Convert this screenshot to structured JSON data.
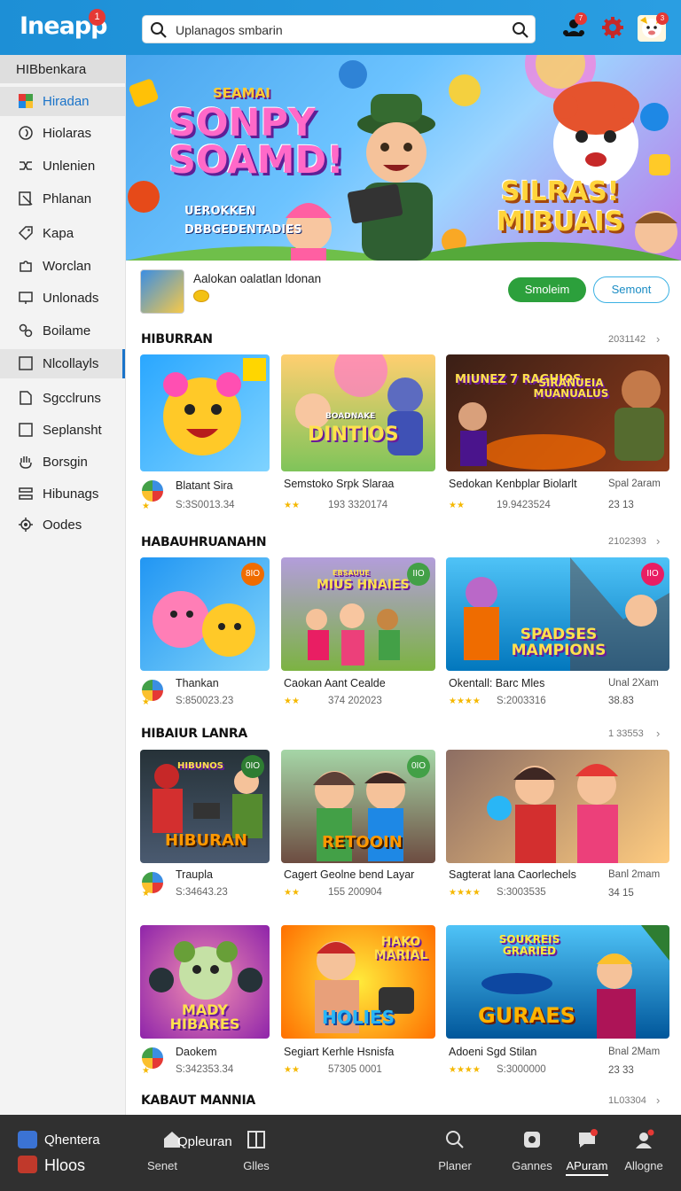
{
  "app": {
    "logo_text": "Ineapp",
    "logo_badge": "1"
  },
  "search": {
    "value": "Uplanagos smbarin"
  },
  "top_icons": [
    {
      "name": "people-icon",
      "badge": "7"
    },
    {
      "name": "gear-icon"
    },
    {
      "name": "avatar",
      "badge": "3"
    }
  ],
  "sidebar": {
    "header": "HIBbenkara",
    "items": [
      {
        "label": "Hiradan",
        "icon": "game-colorful-icon",
        "state": "active"
      },
      {
        "label": "Hiolaras",
        "icon": "swirl-icon"
      },
      {
        "label": "Unlenien",
        "icon": "shuffle-icon"
      },
      {
        "label": "Phlanan",
        "icon": "document-edit-icon"
      },
      {
        "label": "Kapa",
        "icon": "tag-icon"
      },
      {
        "label": "Worclan",
        "icon": "puzzle-icon"
      },
      {
        "label": "Unlonads",
        "icon": "monitor-icon"
      },
      {
        "label": "Boilame",
        "icon": "cluster-icon"
      },
      {
        "label": "Nlcollayls",
        "icon": "checkbox-icon",
        "state": "boxed"
      },
      {
        "label": "Sgcclruns",
        "icon": "page-icon"
      },
      {
        "label": "Seplansht",
        "icon": "square-icon"
      },
      {
        "label": "Borsgin",
        "icon": "hand-icon"
      },
      {
        "label": "Hibunags",
        "icon": "stack-icon"
      },
      {
        "label": "Oodes",
        "icon": "gear-icon"
      }
    ]
  },
  "hero": {
    "small_title": "SEAMAI",
    "main_title_1": "SONPY",
    "main_title_2": "SOAMD!",
    "subtitle_1": "UEROKKEN",
    "subtitle_2": "DBBGEDENTADIES",
    "right_title_1": "SILRAS!",
    "right_title_2": "MIBUAIS"
  },
  "featured": {
    "title": "Aalokan oalatlan ldonan",
    "primary_button": "Smoleim",
    "secondary_button": "Semont"
  },
  "sections": [
    {
      "title": "HIBURRAN",
      "meta": "2031142",
      "cards": [
        {
          "name": "Blatant Sira",
          "sub": "S:3S0013.34",
          "art": "",
          "badge": "",
          "rating": "★"
        },
        {
          "name": "Semstoko Srpk Slaraa",
          "sub": "193 3320174",
          "art": "DINTIOS",
          "art_top": "BOADNAKE",
          "badge": "",
          "rating": "★★"
        },
        {
          "name": "Sedokan Kenbplar Biolarlt",
          "sub": "19.9423524",
          "art": "SIRANUEIA MUANUALUS",
          "art_top": "MIUNEZ 7 RAGHIOS",
          "badge": "",
          "rating": "★★",
          "right_top": "Spal 2aram",
          "right_bottom": "23 13"
        }
      ]
    },
    {
      "title": "HABAUHRUANAHN",
      "meta": "2102393",
      "cards": [
        {
          "name": "Thankan",
          "sub": "S:850023.23",
          "art": "",
          "badge": "8IO",
          "rating": "★"
        },
        {
          "name": "Caokan Aant Cealde",
          "sub": "374 202023",
          "art": "MIUS HNAIES",
          "art_top": "EBSAUUE",
          "badge": "IIO",
          "rating": "★★"
        },
        {
          "name": "Okentall: Barc Mles",
          "sub": "S:2003316",
          "art": "SPADSES MAMPIONS",
          "badge": "IIO",
          "rating": "★★★★",
          "right_top": "Unal 2Xam",
          "right_bottom": "38.83"
        }
      ]
    },
    {
      "title": "HIBAIUR LANRA",
      "meta": "1 33553",
      "cards": [
        {
          "name": "Traupla",
          "sub": "S:34643.23",
          "art": "HIBURAN",
          "art_top": "HIBUNOS",
          "badge": "0IO",
          "rating": "★"
        },
        {
          "name": "Cagert Geolne bend Layar",
          "sub": "155 200904",
          "art": "RETOOIN",
          "badge": "0IO",
          "rating": "★★"
        },
        {
          "name": "Sagterat lana Caorlechels",
          "sub": "S:3003535",
          "art": "",
          "badge": "",
          "rating": "★★★★",
          "right_top": "Banl 2mam",
          "right_bottom": "34 15"
        }
      ]
    },
    {
      "title": "",
      "meta": "",
      "cards": [
        {
          "name": "Daokem",
          "sub": "S:342353.34",
          "art": "MADY HIBARES",
          "badge": "",
          "rating": "★"
        },
        {
          "name": "Segiart Kerhle Hsnisfa",
          "sub": "57305 0001",
          "art": "HOLIES",
          "art_top": "HAKO MARIAL",
          "badge": "",
          "rating": "★★"
        },
        {
          "name": "Adoeni Sgd Stilan",
          "sub": "S:3000000",
          "art": "GURAES",
          "art_top": "SOUKREIS GRARIED",
          "badge": "",
          "rating": "★★★★",
          "right_top": "Bnal 2Mam",
          "right_bottom": "23 33"
        }
      ]
    }
  ],
  "bottom_section": {
    "title": "KABAUT MANNIA",
    "meta": "1L03304"
  },
  "bottombar": {
    "left_top": "Qhentera",
    "left_bottom": "Hloos",
    "items": [
      {
        "label": "Senet",
        "icon": "home-icon",
        "extra": "Qpleuran"
      },
      {
        "label": "Glles",
        "icon": "grid-icon"
      },
      {
        "label": "Planer",
        "icon": "search-icon"
      },
      {
        "label": "Gannes",
        "icon": "gamepad-icon"
      },
      {
        "label": "APuram",
        "icon": "chat-icon",
        "state": "active"
      },
      {
        "label": "Allogne",
        "icon": "profile-icon"
      }
    ]
  },
  "colors": {
    "topbar": "#1d8fd6",
    "accent_green": "#2ca03c",
    "accent_blue": "#1a73c9",
    "bottombar": "#303030"
  }
}
